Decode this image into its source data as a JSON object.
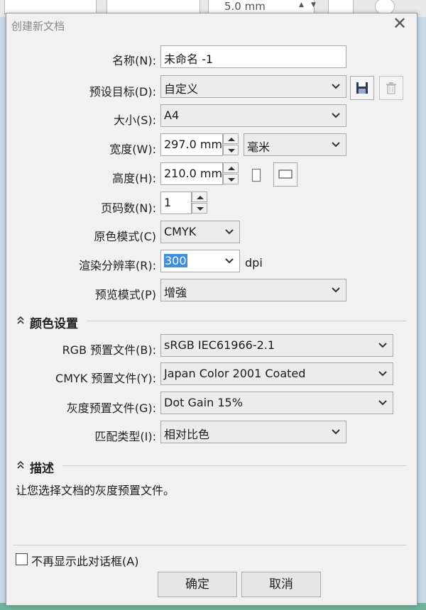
{
  "background": {
    "toolbar_value": "5.0 mm"
  },
  "dialog": {
    "title": "创建新文档",
    "close_label": "✕",
    "fields": {
      "name": {
        "label": "名称(N):",
        "value": "未命名 -1"
      },
      "preset": {
        "label": "预设目标(D):",
        "value": "自定义"
      },
      "size": {
        "label": "大小(S):",
        "value": "A4"
      },
      "width": {
        "label": "宽度(W):",
        "value": "297.0 mm",
        "unit": "毫米"
      },
      "height": {
        "label": "高度(H):",
        "value": "210.0 mm"
      },
      "pages": {
        "label": "页码数(N):",
        "value": "1"
      },
      "color_mode": {
        "label": "原色模式(C)",
        "value": "CMYK"
      },
      "resolution": {
        "label": "渲染分辨率(R):",
        "value": "300",
        "unit": "dpi"
      },
      "preview_mode": {
        "label": "预览模式(P)",
        "value": "增強"
      }
    },
    "color_settings": {
      "header": "颜色设置",
      "rgb_profile": {
        "label": "RGB 预置文件(B):",
        "value": "sRGB IEC61966-2.1"
      },
      "cmyk_profile": {
        "label": "CMYK 预置文件(Y):",
        "value": "Japan Color 2001 Coated"
      },
      "gray_profile": {
        "label": "灰度预置文件(G):",
        "value": "Dot Gain 15%"
      },
      "matching": {
        "label": "匹配类型(I):",
        "value": "相对比色"
      }
    },
    "description": {
      "header": "描述",
      "text": "让您选择文档的灰度预置文件。"
    },
    "dont_show_label": "不再显示此对话框(A)",
    "ok_label": "确定",
    "cancel_label": "取消"
  },
  "colors": {
    "selection": "#3b8ee6",
    "dialog_bg": "#f1f1f1"
  }
}
